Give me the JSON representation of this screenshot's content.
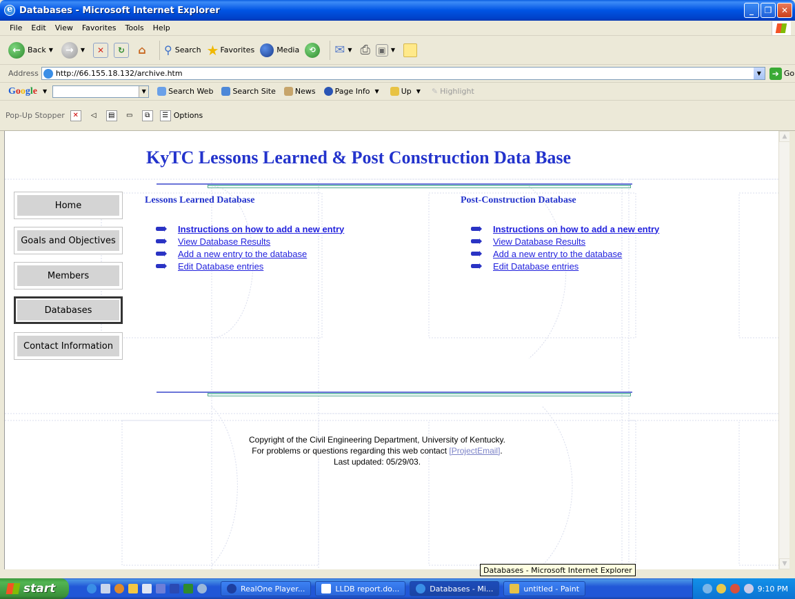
{
  "window": {
    "title": "Databases - Microsoft Internet Explorer"
  },
  "menu": [
    "File",
    "Edit",
    "View",
    "Favorites",
    "Tools",
    "Help"
  ],
  "toolbar": {
    "back": "Back",
    "search": "Search",
    "favorites": "Favorites",
    "media": "Media"
  },
  "address": {
    "label": "Address",
    "url": "http://66.155.18.132/archive.htm",
    "go": "Go"
  },
  "googlebar": {
    "logo": "Google",
    "search_web": "Search Web",
    "search_site": "Search Site",
    "news": "News",
    "page_info": "Page Info",
    "up": "Up",
    "highlight": "Highlight"
  },
  "popup": {
    "label": "Pop-Up Stopper",
    "options": "Options"
  },
  "page": {
    "title": "KyTC Lessons Learned & Post Construction Data Base",
    "nav": [
      "Home",
      "Goals and Objectives",
      "Members",
      "Databases",
      "Contact Information"
    ],
    "lessons": {
      "heading": "Lessons Learned Database",
      "links": [
        "Instructions on how to add a new entry",
        "View Database Results",
        "Add a new entry to the database",
        "Edit Database entries"
      ]
    },
    "post": {
      "heading": "Post-Construction Database",
      "links": [
        "Instructions on how to add a new entry",
        "View Database Results",
        "Add a new entry to the database",
        "Edit Database entries"
      ]
    },
    "footer": {
      "line1": "Copyright of the Civil Engineering Department, University of Kentucky.",
      "line2": "For problems or questions regarding this web contact",
      "email": "[ProjectEmail]",
      "line3": "Last updated: 05/29/03."
    }
  },
  "tooltip": "Databases - Microsoft Internet Explorer",
  "taskbar": {
    "start": "start",
    "tasks": [
      "RealOne Player...",
      "LLDB report.do...",
      "Databases - Mi...",
      "untitled - Paint"
    ],
    "clock": "9:10 PM"
  }
}
